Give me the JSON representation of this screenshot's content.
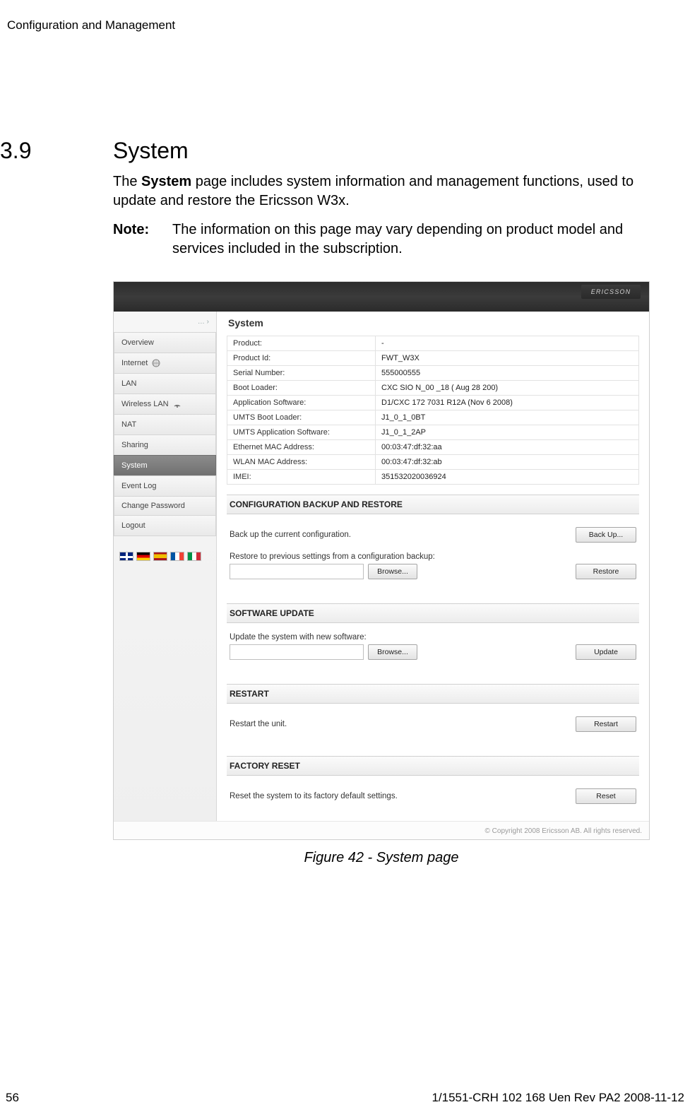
{
  "doc": {
    "running_header": "Configuration and Management",
    "section_number": "3.9",
    "section_title": "System",
    "para1_pre": "The ",
    "para1_bold": "System",
    "para1_post": " page includes system information and management functions, used to update and restore the Ericsson W3x.",
    "note_label": "Note:",
    "note_text": "The information on this page may vary depending on product model and services included in the subscription.",
    "caption": "Figure 42 - System page",
    "page_number": "56",
    "doc_id": "1/1551-CRH 102 168 Uen Rev PA2  2008-11-12"
  },
  "ui": {
    "logo": "ERICSSON",
    "crumb": "… ›",
    "nav": {
      "overview": "Overview",
      "internet": "Internet",
      "lan": "LAN",
      "wlan": "Wireless LAN",
      "nat": "NAT",
      "sharing": "Sharing",
      "system": "System",
      "eventlog": "Event Log",
      "changepw": "Change Password",
      "logout": "Logout"
    },
    "page_title": "System",
    "info": {
      "product_l": "Product:",
      "product_v": "-",
      "pid_l": "Product Id:",
      "pid_v": "FWT_W3X",
      "serial_l": "Serial Number:",
      "serial_v": "555000555",
      "boot_l": "Boot Loader:",
      "boot_v": "CXC SIO N_00 _18 ( Aug 28 200)",
      "app_l": "Application Software:",
      "app_v": "D1/CXC 172 7031 R12A (Nov 6 2008)",
      "uboot_l": "UMTS Boot Loader:",
      "uboot_v": "J1_0_1_0BT",
      "uapp_l": "UMTS Application Software:",
      "uapp_v": "J1_0_1_2AP",
      "eth_l": "Ethernet MAC Address:",
      "eth_v": "00:03:47:df:32:aa",
      "wlan_l": "WLAN MAC Address:",
      "wlan_v": "00:03:47:df:32:ab",
      "imei_l": "IMEI:",
      "imei_v": "351532020036924"
    },
    "sections": {
      "backup_title": "CONFIGURATION BACKUP AND RESTORE",
      "backup_text": "Back up the current configuration.",
      "backup_btn": "Back Up...",
      "restore_text": "Restore to previous settings from a configuration backup:",
      "browse_btn": "Browse...",
      "restore_btn": "Restore",
      "swupdate_title": "SOFTWARE UPDATE",
      "swupdate_text": "Update the system with new software:",
      "update_btn": "Update",
      "restart_title": "RESTART",
      "restart_text": "Restart the unit.",
      "restart_btn": "Restart",
      "factory_title": "FACTORY RESET",
      "factory_text": "Reset the system to its factory default settings.",
      "reset_btn": "Reset"
    },
    "footer": "© Copyright 2008 Ericsson AB. All rights reserved."
  }
}
